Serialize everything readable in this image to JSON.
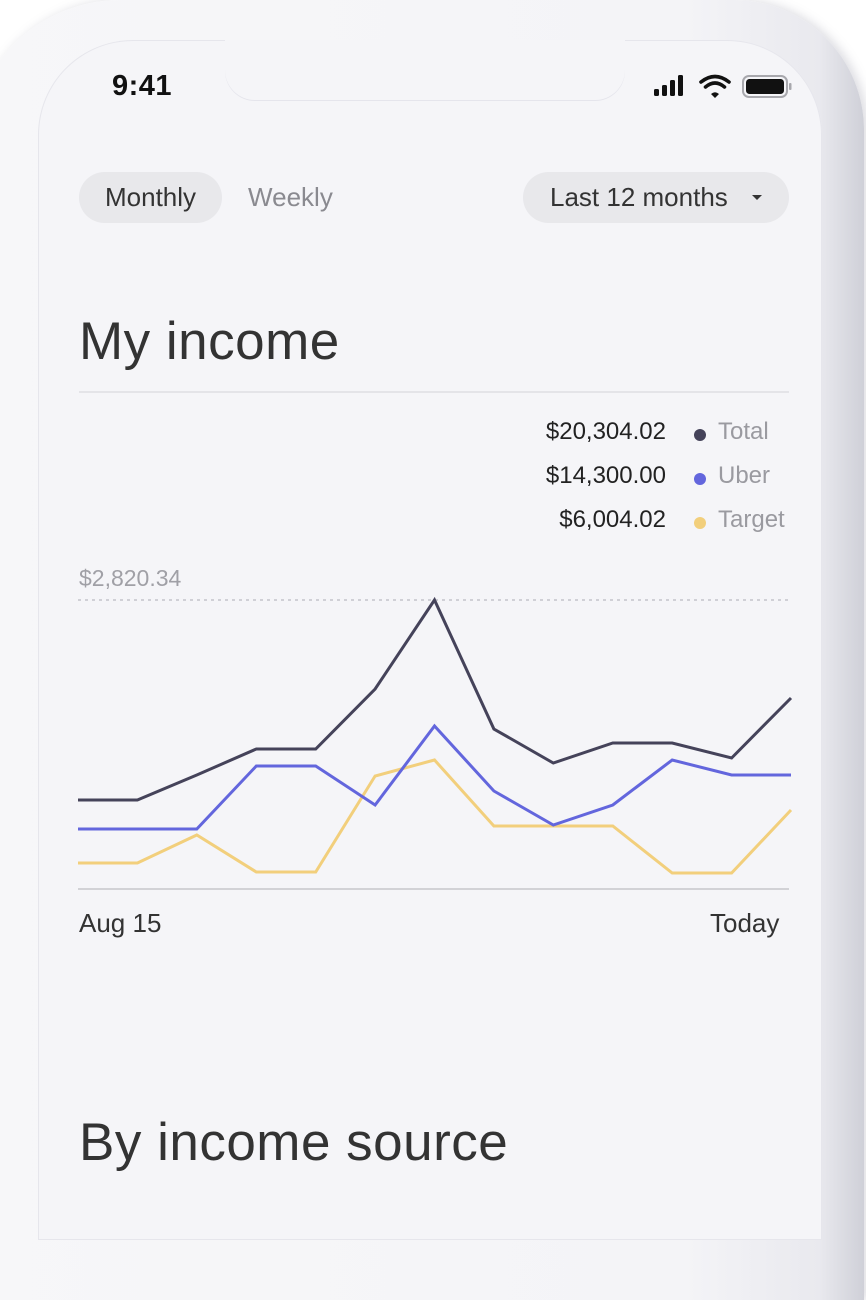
{
  "status_bar": {
    "time": "9:41",
    "icons": [
      "cellular-signal-icon",
      "wifi-icon",
      "battery-icon"
    ]
  },
  "period_tabs": [
    {
      "label": "Monthly",
      "active": true
    },
    {
      "label": "Weekly",
      "active": false
    }
  ],
  "range_select": {
    "value": "Last 12 months",
    "icon": "caret-down-icon"
  },
  "income_section": {
    "title": "My income"
  },
  "source_section": {
    "title": "By income source"
  },
  "colors": {
    "total": "#45435a",
    "uber": "#6366dd",
    "target": "#f2cf7c",
    "background": "#f5f5f8"
  },
  "chart_data": {
    "type": "line",
    "title": "My income",
    "xlabel": "",
    "ylabel": "",
    "x_start_label": "Aug 15",
    "x_end_label": "Today",
    "reference_line": {
      "value": 2820.34,
      "label": "$2,820.34",
      "style": "dashed"
    },
    "ylim": [
      0,
      2820.34
    ],
    "grid": false,
    "legend_position": "top-right",
    "legend": [
      {
        "name": "Total",
        "amount": "$20,304.02",
        "color": "#45435a"
      },
      {
        "name": "Uber",
        "amount": "$14,300.00",
        "color": "#6366dd"
      },
      {
        "name": "Target",
        "amount": "$6,004.02",
        "color": "#f2cf7c"
      }
    ],
    "point_count": 13,
    "series": [
      {
        "name": "Total",
        "color": "#45435a",
        "values": [
          869,
          869,
          1113,
          1366,
          1366,
          1952,
          2820,
          1561,
          1230,
          1425,
          1425,
          1278,
          1864
        ]
      },
      {
        "name": "Uber",
        "color": "#6366dd",
        "values": [
          586,
          586,
          586,
          1200,
          1200,
          820,
          1591,
          956,
          625,
          820,
          1259,
          1113,
          1113
        ]
      },
      {
        "name": "Target",
        "color": "#f2cf7c",
        "values": [
          254,
          254,
          527,
          166,
          166,
          1103,
          1259,
          615,
          615,
          615,
          156,
          156,
          771
        ]
      }
    ]
  }
}
